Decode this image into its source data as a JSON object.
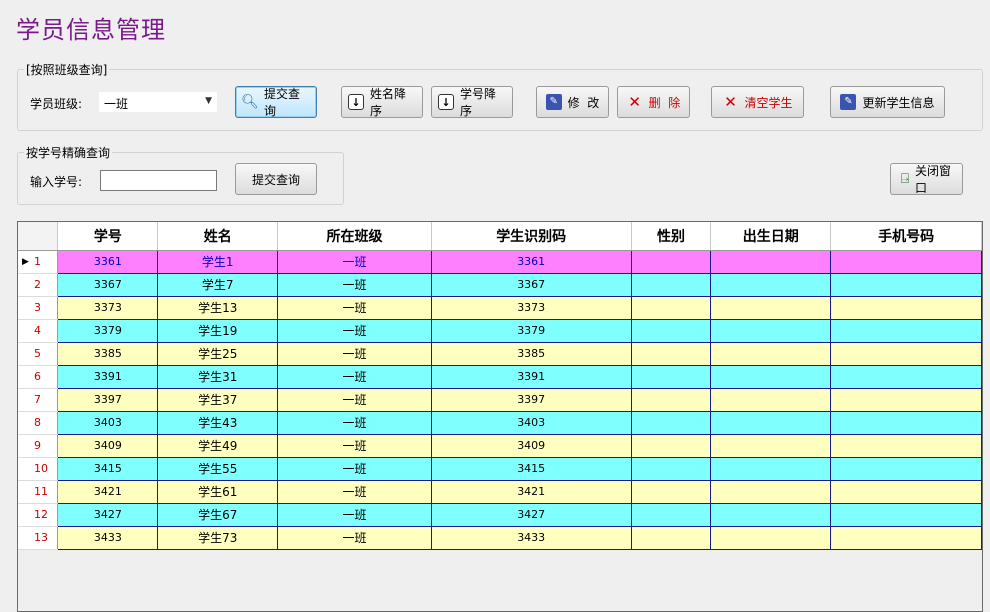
{
  "page_title": "学员信息管理",
  "class_group": {
    "legend": "[按照班级查询]",
    "class_label": "学员班级:",
    "class_value": "一班",
    "buttons": {
      "submit_query": "提交查询",
      "name_desc": "姓名降序",
      "id_desc": "学号降序",
      "edit": "修  改",
      "delete": "删  除",
      "clear_students": "清空学生",
      "update_info": "更新学生信息"
    }
  },
  "id_group": {
    "legend": "按学号精确查询",
    "id_label": "输入学号:",
    "id_value": "",
    "submit_query": "提交查询"
  },
  "close_button": "关闭窗口",
  "table": {
    "columns": [
      "学号",
      "姓名",
      "所在班级",
      "学生识别码",
      "性别",
      "出生日期",
      "手机号码"
    ],
    "selected_row": 1,
    "rows": [
      {
        "n": "1",
        "id": "3361",
        "name": "学生1",
        "class": "一班",
        "code": "3361",
        "gender": "",
        "birth": "",
        "phone": ""
      },
      {
        "n": "2",
        "id": "3367",
        "name": "学生7",
        "class": "一班",
        "code": "3367",
        "gender": "",
        "birth": "",
        "phone": ""
      },
      {
        "n": "3",
        "id": "3373",
        "name": "学生13",
        "class": "一班",
        "code": "3373",
        "gender": "",
        "birth": "",
        "phone": ""
      },
      {
        "n": "4",
        "id": "3379",
        "name": "学生19",
        "class": "一班",
        "code": "3379",
        "gender": "",
        "birth": "",
        "phone": ""
      },
      {
        "n": "5",
        "id": "3385",
        "name": "学生25",
        "class": "一班",
        "code": "3385",
        "gender": "",
        "birth": "",
        "phone": ""
      },
      {
        "n": "6",
        "id": "3391",
        "name": "学生31",
        "class": "一班",
        "code": "3391",
        "gender": "",
        "birth": "",
        "phone": ""
      },
      {
        "n": "7",
        "id": "3397",
        "name": "学生37",
        "class": "一班",
        "code": "3397",
        "gender": "",
        "birth": "",
        "phone": ""
      },
      {
        "n": "8",
        "id": "3403",
        "name": "学生43",
        "class": "一班",
        "code": "3403",
        "gender": "",
        "birth": "",
        "phone": ""
      },
      {
        "n": "9",
        "id": "3409",
        "name": "学生49",
        "class": "一班",
        "code": "3409",
        "gender": "",
        "birth": "",
        "phone": ""
      },
      {
        "n": "10",
        "id": "3415",
        "name": "学生55",
        "class": "一班",
        "code": "3415",
        "gender": "",
        "birth": "",
        "phone": ""
      },
      {
        "n": "11",
        "id": "3421",
        "name": "学生61",
        "class": "一班",
        "code": "3421",
        "gender": "",
        "birth": "",
        "phone": ""
      },
      {
        "n": "12",
        "id": "3427",
        "name": "学生67",
        "class": "一班",
        "code": "3427",
        "gender": "",
        "birth": "",
        "phone": ""
      },
      {
        "n": "13",
        "id": "3433",
        "name": "学生73",
        "class": "一班",
        "code": "3433",
        "gender": "",
        "birth": "",
        "phone": ""
      }
    ]
  },
  "colors": {
    "title": "#7a1a8a",
    "row_selected": "#ff80ff",
    "row_odd": "#80ffff",
    "row_even": "#ffffc0",
    "row_header_text": "#cc0000"
  },
  "icons": {
    "submit_query": "search-icon",
    "name_desc": "arrow-down-icon",
    "id_desc": "arrow-down-icon",
    "edit": "notepad-icon",
    "delete": "x-icon",
    "clear_students": "x-icon",
    "update_info": "notepad-icon",
    "close": "exit-door-icon"
  }
}
